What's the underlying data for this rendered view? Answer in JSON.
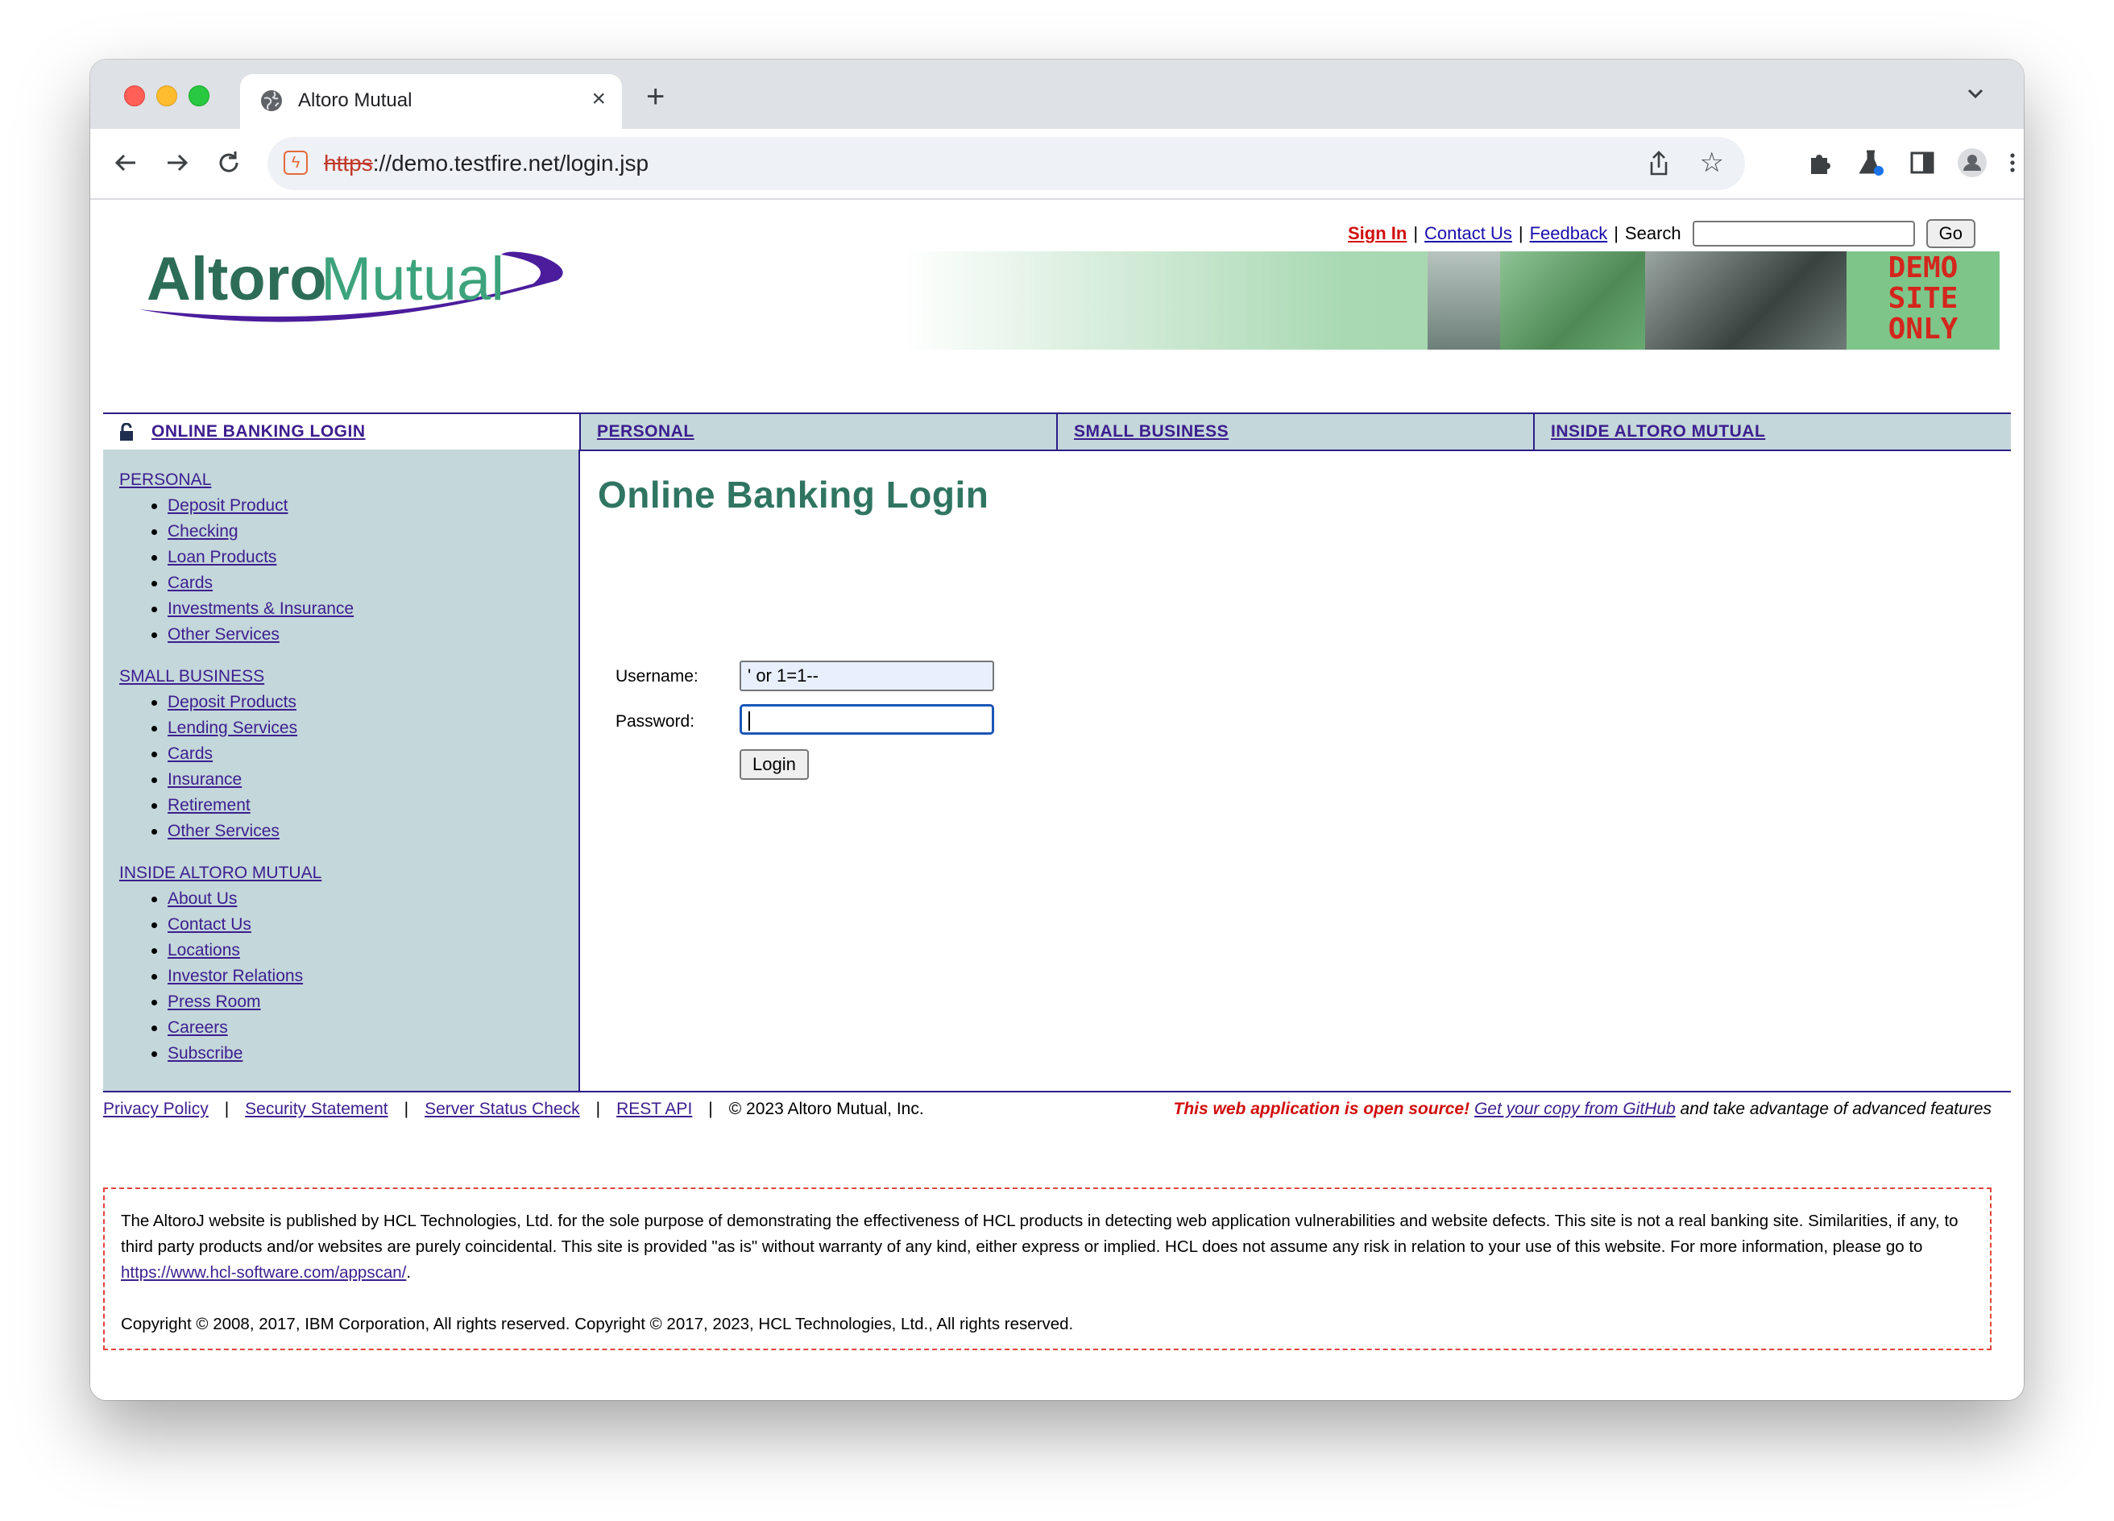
{
  "browser": {
    "tab_title": "Altoro Mutual",
    "url_scheme": "https",
    "url_rest": "://demo.testfire.net/login.jsp",
    "url_host": "demo.testfire.net",
    "url_path": "/login.jsp"
  },
  "header": {
    "logo_text_1": "Altoro",
    "logo_text_2": "Mutual",
    "sign_in": "Sign In",
    "contact_us": "Contact Us",
    "feedback": "Feedback",
    "search_label": "Search",
    "search_value": "",
    "go_label": "Go",
    "demo_badge": "DEMO\nSITE\nONLY"
  },
  "nav": {
    "online_banking": "ONLINE BANKING LOGIN",
    "personal": "PERSONAL",
    "small_business": "SMALL BUSINESS",
    "inside": "INSIDE ALTORO MUTUAL"
  },
  "sidebar": {
    "personal": {
      "title": "PERSONAL",
      "items": [
        "Deposit Product",
        "Checking",
        "Loan Products",
        "Cards",
        "Investments & Insurance",
        "Other Services"
      ]
    },
    "small_business": {
      "title": "SMALL BUSINESS",
      "items": [
        "Deposit Products",
        "Lending Services",
        "Cards",
        "Insurance",
        "Retirement",
        "Other Services"
      ]
    },
    "inside": {
      "title": "INSIDE ALTORO MUTUAL",
      "items": [
        "About Us",
        "Contact Us",
        "Locations",
        "Investor Relations",
        "Press Room",
        "Careers",
        "Subscribe"
      ]
    }
  },
  "main": {
    "title": "Online Banking Login",
    "username_label": "Username:",
    "username_value": "' or 1=1--",
    "password_label": "Password:",
    "password_value": "",
    "login_button": "Login"
  },
  "footer": {
    "privacy": "Privacy Policy",
    "security": "Security Statement",
    "server_status": "Server Status Check",
    "rest_api": "REST API",
    "copyright": "© 2023 Altoro Mutual, Inc.",
    "open_source": "This web application is open source!",
    "github_link": "Get your copy from GitHub",
    "open_source_tail": " and take advantage of advanced features"
  },
  "disclaimer": {
    "text_1": "The AltoroJ website is published by HCL Technologies, Ltd. for the sole purpose of demonstrating the effectiveness of HCL products in detecting web application vulnerabilities and website defects. This site is not a real banking site. Similarities, if any, to third party products and/or websites are purely coincidental. This site is provided \"as is\" without warranty of any kind, either express or implied. HCL does not assume any risk in relation to your use of this website. For more information, please go to ",
    "link": "https://www.hcl-software.com/appscan/",
    "text_1_end": ".",
    "copyright": "Copyright © 2008, 2017, IBM Corporation, All rights reserved. Copyright © 2017, 2023, HCL Technologies, Ltd., All rights reserved."
  },
  "colors": {
    "nav_bg": "#c4d7da",
    "nav_border": "#2c1e87",
    "title_green": "#2f7561",
    "sign_in_red": "#d20e0e"
  }
}
